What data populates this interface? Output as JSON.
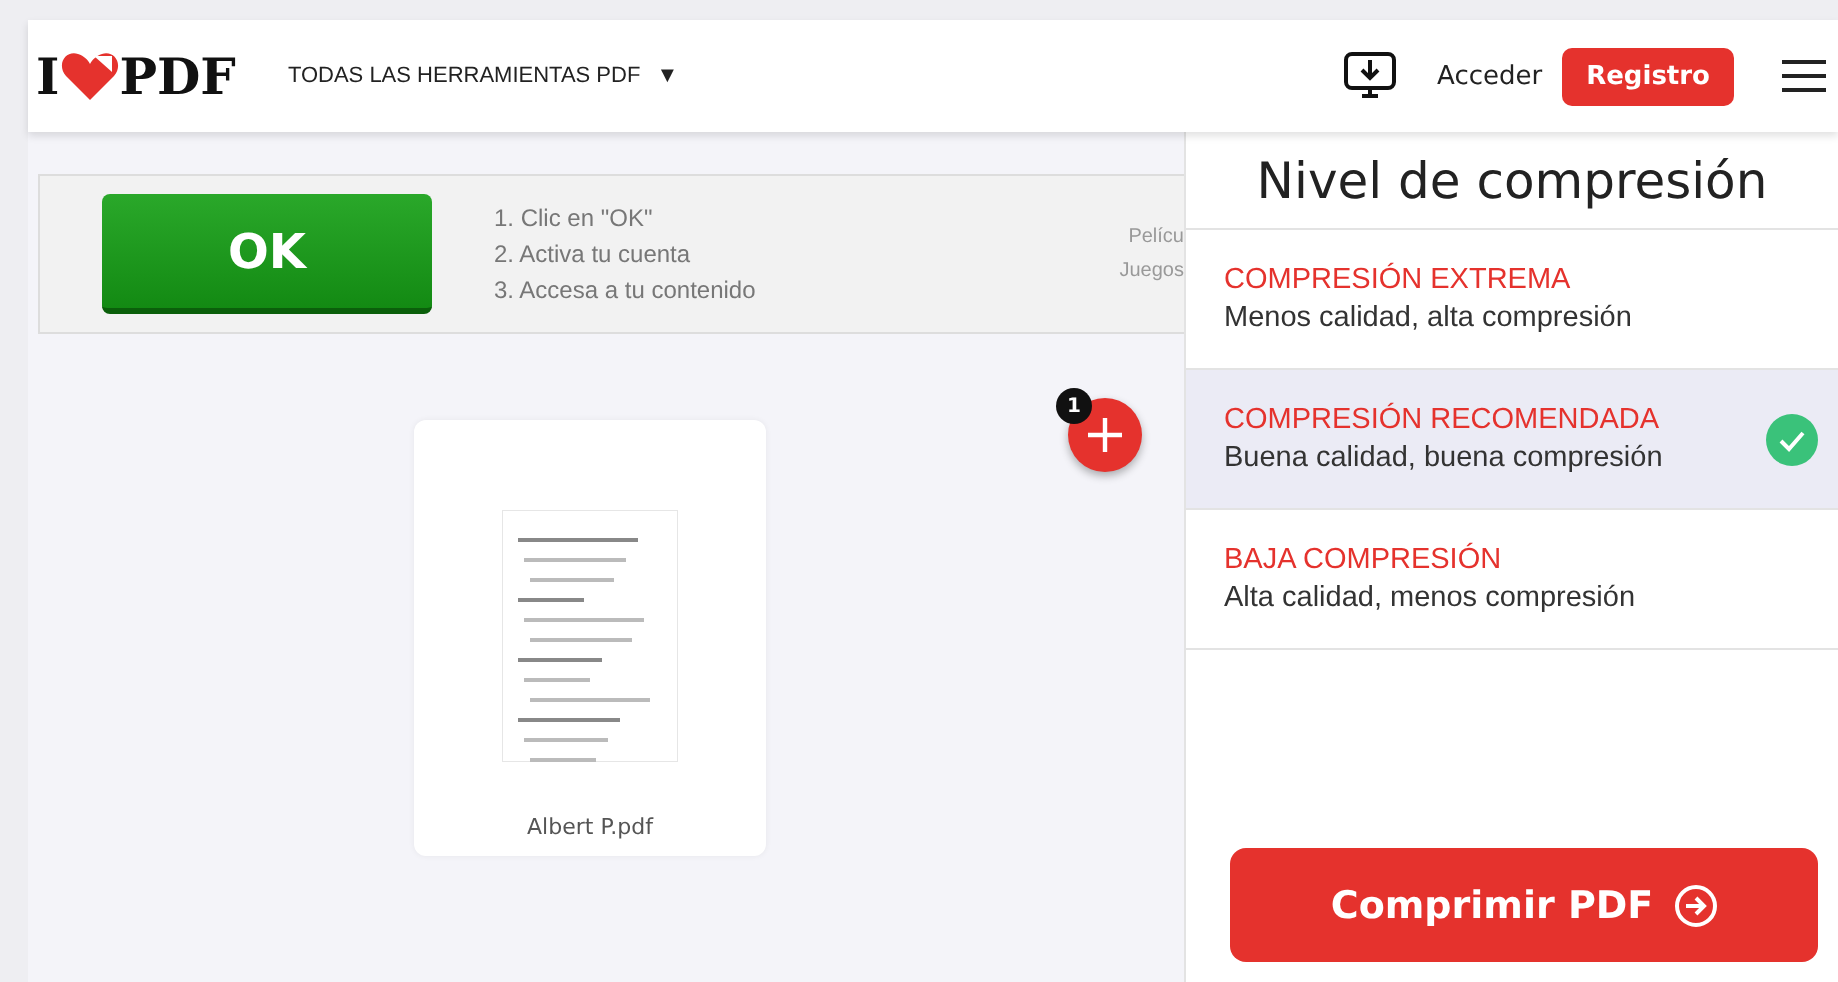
{
  "header": {
    "logo_left": "I",
    "logo_right": "PDF",
    "tools_menu": "TODAS LAS HERRAMIENTAS PDF",
    "tools_caret": "▼",
    "login": "Acceder",
    "register": "Registro"
  },
  "ad": {
    "button": "OK",
    "steps": [
      "1. Clic en \"OK\"",
      "2. Activa tu cuenta",
      "3. Accesa a tu contenido"
    ],
    "side_texts": [
      "Pelícu",
      "Juegos"
    ]
  },
  "files": [
    {
      "name": "Albert P.pdf",
      "kind": "picture"
    }
  ],
  "add_button": {
    "count": "1"
  },
  "panel": {
    "title": "Nivel de compresión",
    "options": [
      {
        "title": "COMPRESIÓN EXTREMA",
        "subtitle": "Menos calidad, alta compresión",
        "selected": false
      },
      {
        "title": "COMPRESIÓN RECOMENDADA",
        "subtitle": "Buena calidad, buena compresión",
        "selected": true
      },
      {
        "title": "BAJA COMPRESIÓN",
        "subtitle": "Alta calidad, menos compresión",
        "selected": false
      }
    ],
    "action": "Comprimir PDF"
  }
}
